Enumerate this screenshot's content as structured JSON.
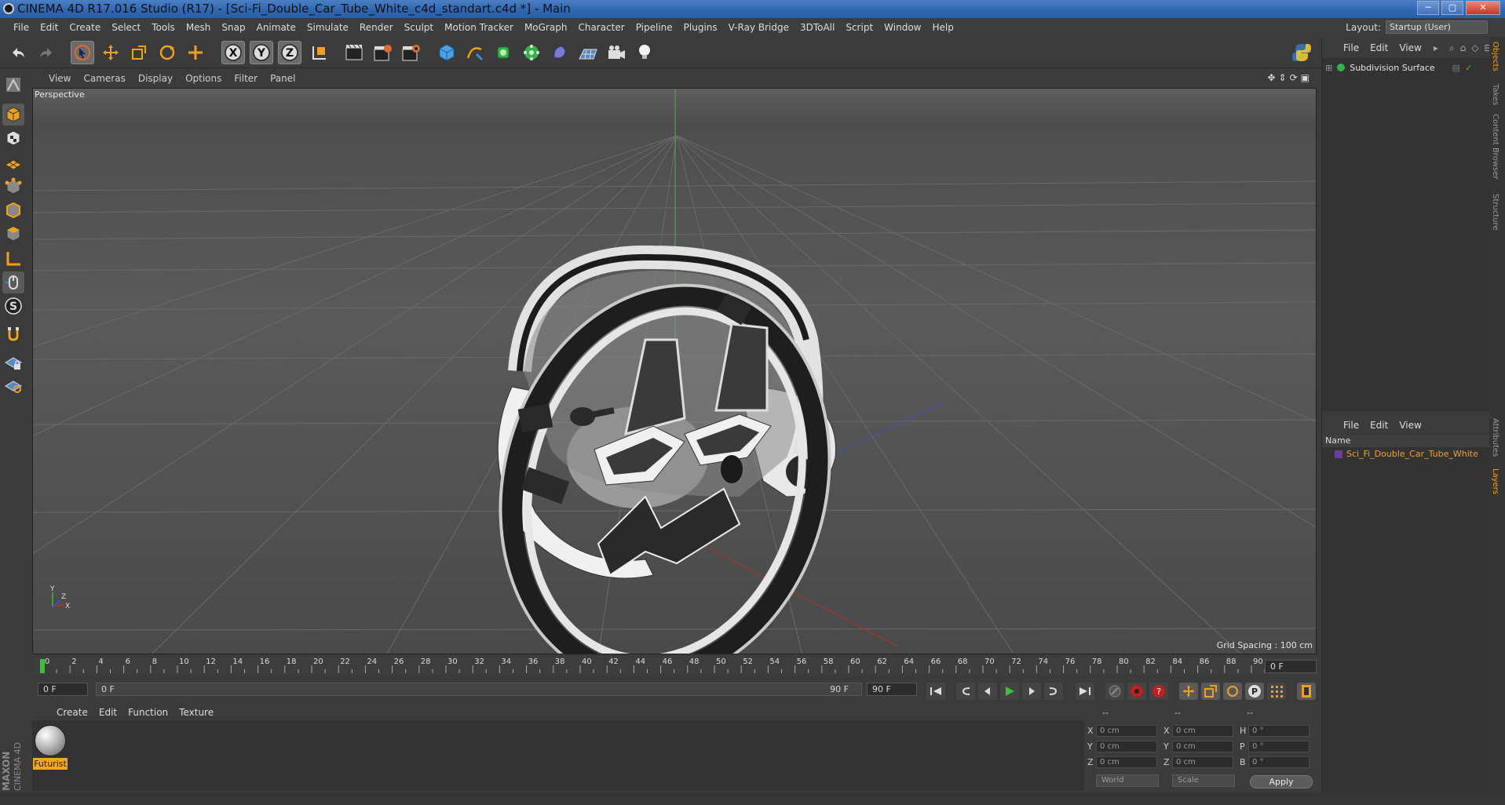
{
  "window": {
    "title": "CINEMA 4D R17.016 Studio (R17) - [Sci-Fi_Double_Car_Tube_White_c4d_standart.c4d *] - Main"
  },
  "menubar": {
    "items": [
      "File",
      "Edit",
      "Create",
      "Select",
      "Tools",
      "Mesh",
      "Snap",
      "Animate",
      "Simulate",
      "Render",
      "Sculpt",
      "Motion Tracker",
      "MoGraph",
      "Character",
      "Pipeline",
      "Plugins",
      "V-Ray Bridge",
      "3DToAll",
      "Script",
      "Window",
      "Help"
    ]
  },
  "layout": {
    "label": "Layout:",
    "value": "Startup (User)"
  },
  "viewport": {
    "menu": [
      "View",
      "Cameras",
      "Display",
      "Options",
      "Filter",
      "Panel"
    ],
    "camera_label": "Perspective",
    "grid_spacing": "Grid Spacing : 100 cm"
  },
  "timeline": {
    "ticks": [
      "0",
      "2",
      "4",
      "6",
      "8",
      "10",
      "12",
      "14",
      "16",
      "18",
      "20",
      "22",
      "24",
      "26",
      "28",
      "30",
      "32",
      "34",
      "36",
      "38",
      "40",
      "42",
      "44",
      "46",
      "48",
      "50",
      "52",
      "54",
      "56",
      "58",
      "60",
      "62",
      "64",
      "66",
      "68",
      "70",
      "72",
      "74",
      "76",
      "78",
      "80",
      "82",
      "84",
      "86",
      "88",
      "90"
    ],
    "current_frame": "0 F",
    "start_field": "0 F",
    "range_start": "0 F",
    "range_end": "90 F",
    "end_field": "90 F"
  },
  "material_manager": {
    "menu": [
      "Create",
      "Edit",
      "Function",
      "Texture"
    ],
    "materials": [
      {
        "name": "Futurist"
      }
    ]
  },
  "coordinates": {
    "header": [
      "--",
      "--",
      "--"
    ],
    "rows": [
      {
        "a": "X",
        "av": "0 cm",
        "b": "X",
        "bv": "0 cm",
        "c": "H",
        "cv": "0 °"
      },
      {
        "a": "Y",
        "av": "0 cm",
        "b": "Y",
        "bv": "0 cm",
        "c": "P",
        "cv": "0 °"
      },
      {
        "a": "Z",
        "av": "0 cm",
        "b": "Z",
        "bv": "0 cm",
        "c": "B",
        "cv": "0 °"
      }
    ],
    "mode1": "World",
    "mode2": "Scale",
    "apply": "Apply"
  },
  "object_manager": {
    "menu": [
      "File",
      "Edit",
      "View"
    ],
    "objects": [
      {
        "name": "Subdivision Surface"
      }
    ]
  },
  "layer_manager": {
    "menu": [
      "File",
      "Edit",
      "View"
    ],
    "column": "Name",
    "layers": [
      {
        "name": "Sci_Fi_Double_Car_Tube_White",
        "color": "#6a3fa0"
      }
    ]
  },
  "side_tabs": [
    "Objects",
    "Takes",
    "Content Browser",
    "Structure",
    "Attributes",
    "Layers"
  ],
  "brand": {
    "line1": "MAXON",
    "line2": "CINEMA 4D"
  },
  "colors": {
    "accent_orange": "#f3a71f",
    "axis_x": "#b03030",
    "axis_y": "#2fae2f",
    "axis_z": "#3a4fc0",
    "selected_tool": "#6b6b6b"
  }
}
